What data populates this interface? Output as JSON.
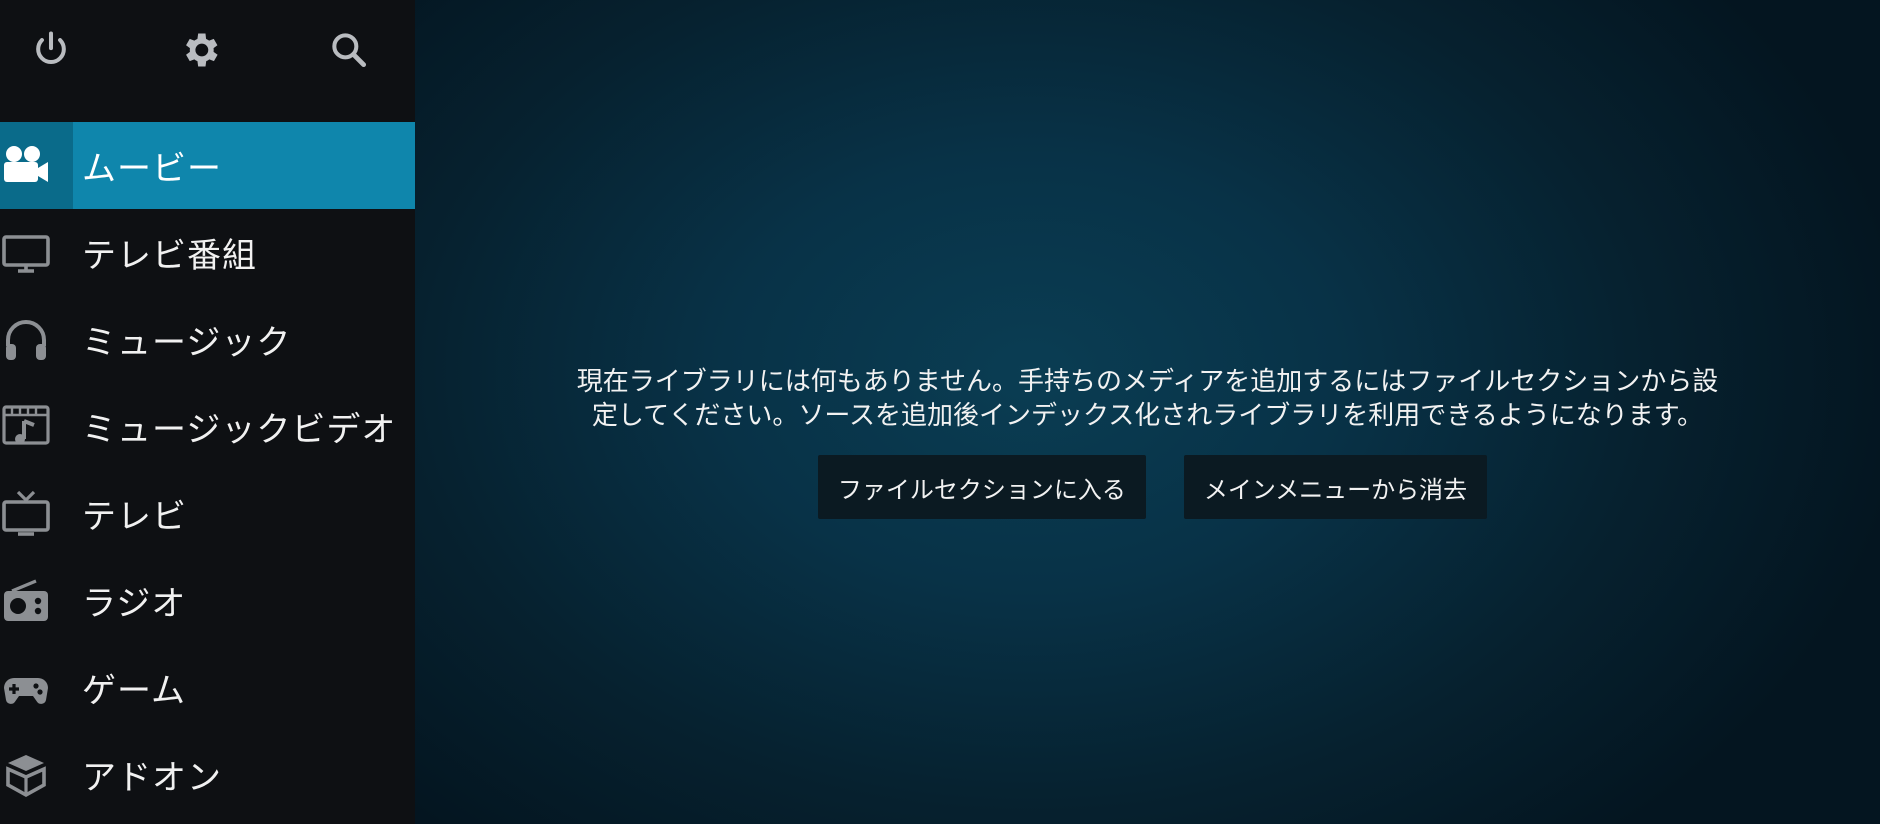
{
  "top_icons": {
    "power": "power-icon",
    "settings": "gear-icon",
    "search": "search-icon"
  },
  "sidebar": {
    "items": [
      {
        "label": "ムービー",
        "icon": "movie-camera-icon",
        "active": true
      },
      {
        "label": "テレビ番組",
        "icon": "monitor-icon",
        "active": false
      },
      {
        "label": "ミュージック",
        "icon": "headphones-icon",
        "active": false
      },
      {
        "label": "ミュージックビデオ",
        "icon": "music-video-icon",
        "active": false
      },
      {
        "label": "テレビ",
        "icon": "tv-antenna-icon",
        "active": false
      },
      {
        "label": "ラジオ",
        "icon": "radio-icon",
        "active": false
      },
      {
        "label": "ゲーム",
        "icon": "gamepad-icon",
        "active": false
      },
      {
        "label": "アドオン",
        "icon": "addon-box-icon",
        "active": false
      }
    ]
  },
  "main": {
    "message_line1": "現在ライブラリには何もありません。手持ちのメディアを追加するにはファイルセクションから設",
    "message_line2": "定してください。ソースを追加後インデックス化されライブラリを利用できるようになります。",
    "buttons": {
      "enter_files": "ファイルセクションに入る",
      "remove_from_menu": "メインメニューから消去"
    }
  },
  "colors": {
    "sidebar_bg": "#0e1013",
    "active_item": "#0f86ac",
    "active_icon_box": "#0a6b8a",
    "main_bg": "#083247",
    "button_bg": "#0b1a22",
    "icon_gray": "#8c8f93"
  }
}
